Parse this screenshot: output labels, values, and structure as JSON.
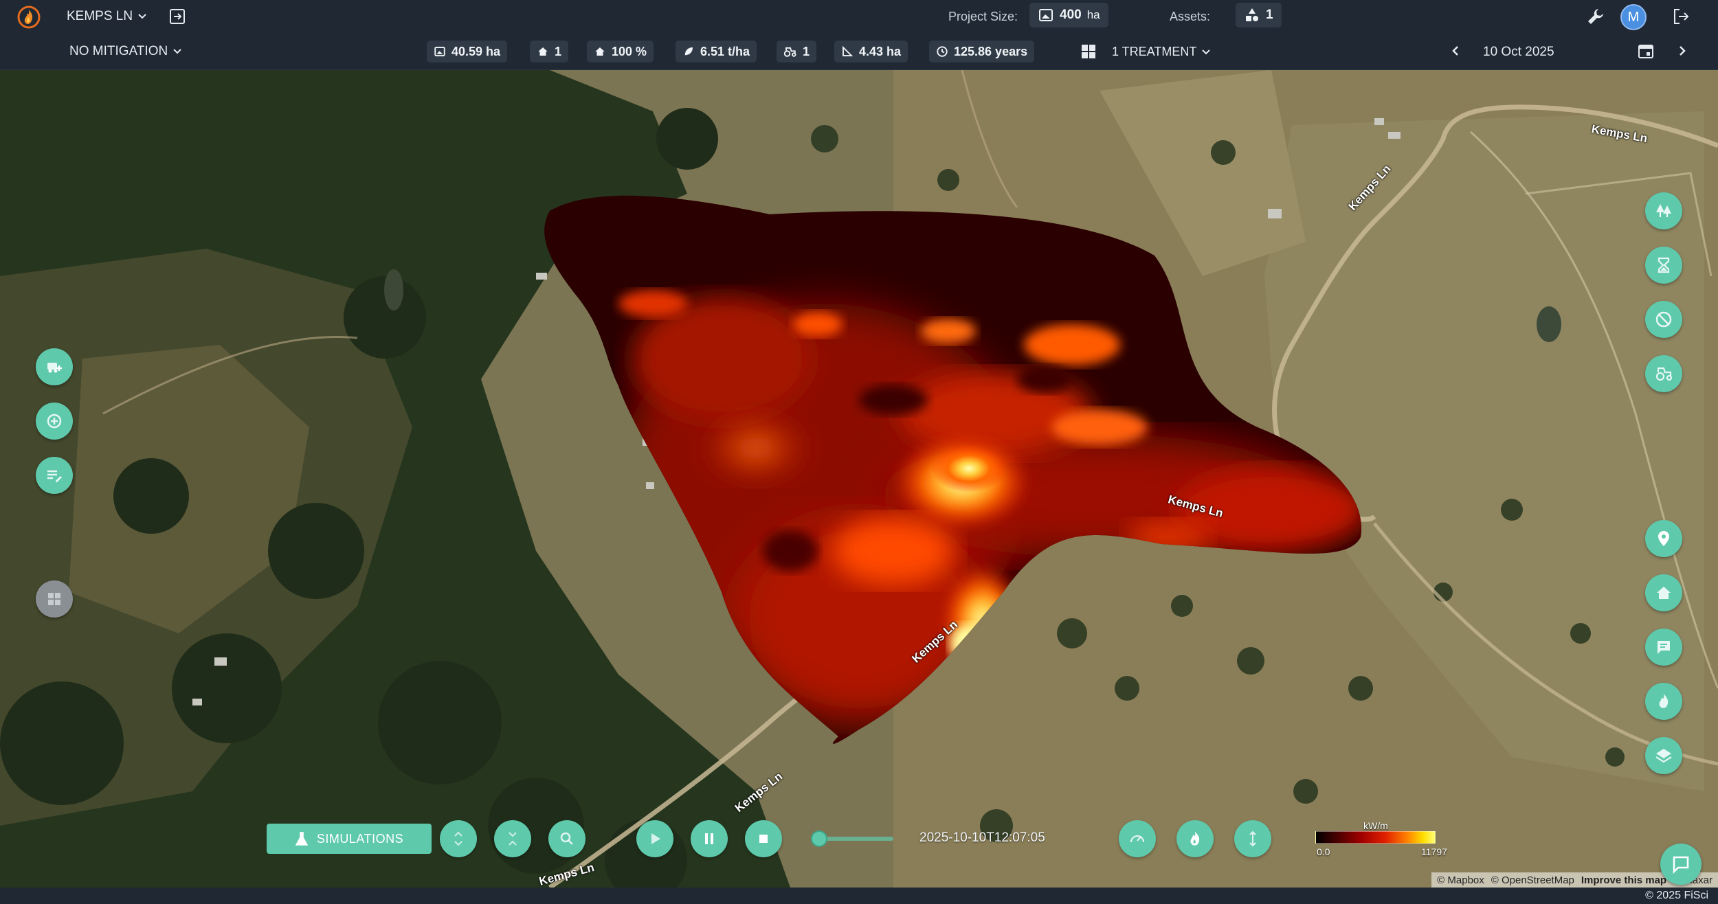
{
  "header": {
    "project_name": "KEMPS LN",
    "project_size_label": "Project Size:",
    "project_size_value": "400",
    "project_size_unit": "ha",
    "assets_label": "Assets:",
    "assets_value": "1",
    "user_initial": "M"
  },
  "subbar": {
    "mitigation": "NO MITIGATION",
    "stats": [
      {
        "icon": "area-icon",
        "value": "40.59 ha"
      },
      {
        "icon": "house-icon",
        "value": "1"
      },
      {
        "icon": "house-icon",
        "value": "100 %"
      },
      {
        "icon": "leaf-icon",
        "value": "6.51 t/ha"
      },
      {
        "icon": "tractor-icon",
        "value": "1"
      },
      {
        "icon": "ruler-area-icon",
        "value": "4.43 ha"
      },
      {
        "icon": "clock-icon",
        "value": "125.86 years"
      }
    ],
    "treatment": "1 TREATMENT",
    "date": "10 Oct 2025"
  },
  "map": {
    "road_labels": [
      "Kemps Ln",
      "Kemps Ln",
      "Kemps Ln",
      "Kemps Ln",
      "Kemps Ln",
      "Kemps Ln"
    ]
  },
  "left_tools": [
    "add-vehicle-icon",
    "zoom-plus-icon",
    "edit-list-icon",
    "dashboard-icon"
  ],
  "right_tools": [
    "trees-icon",
    "hourglass-icon",
    "no-fire-icon",
    "tractor-icon",
    "location-pin-icon",
    "house-icon",
    "comment-icon",
    "fire-icon",
    "layers-icon"
  ],
  "bottom": {
    "simulations_label": "SIMULATIONS",
    "timestamp": "2025-10-10T12:07:05",
    "playback_progress": 0.0
  },
  "legend": {
    "unit": "kW/m",
    "min": "0.0",
    "max": "11797",
    "colors": [
      "#000000",
      "#a00000",
      "#ff8000",
      "#ffff80"
    ]
  },
  "attribution": {
    "mapbox": "© Mapbox",
    "osm": "© OpenStreetMap",
    "improve": "Improve this map",
    "maxar": "© Maxar"
  },
  "footer": {
    "copyright": "© 2025 FiSci"
  },
  "colors": {
    "accent": "#5fc9ac",
    "header_bg": "#1f2833",
    "pill_bg": "#2f3a46",
    "avatar": "#4a8fe0"
  }
}
